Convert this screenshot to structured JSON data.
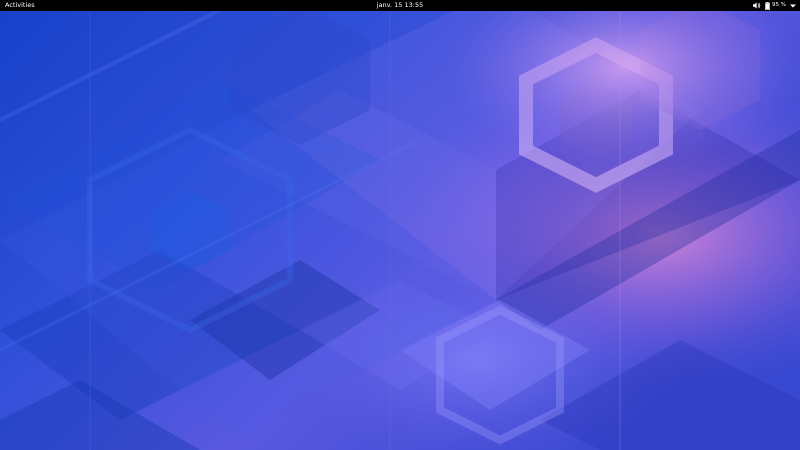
{
  "top_bar": {
    "activities_label": "Activities",
    "clock": "janv. 15  13:55",
    "battery_percent": "95 %",
    "icons": {
      "volume": "volume-icon",
      "battery": "battery-icon",
      "menu_arrow": "chevron-down-icon"
    }
  },
  "colors": {
    "top_bar_bg": "#000000",
    "top_bar_text": "#ffffff",
    "wallpaper_base": "#1a3fc4",
    "wallpaper_violet": "#7a6cf0",
    "wallpaper_pink": "#d58ad8"
  }
}
